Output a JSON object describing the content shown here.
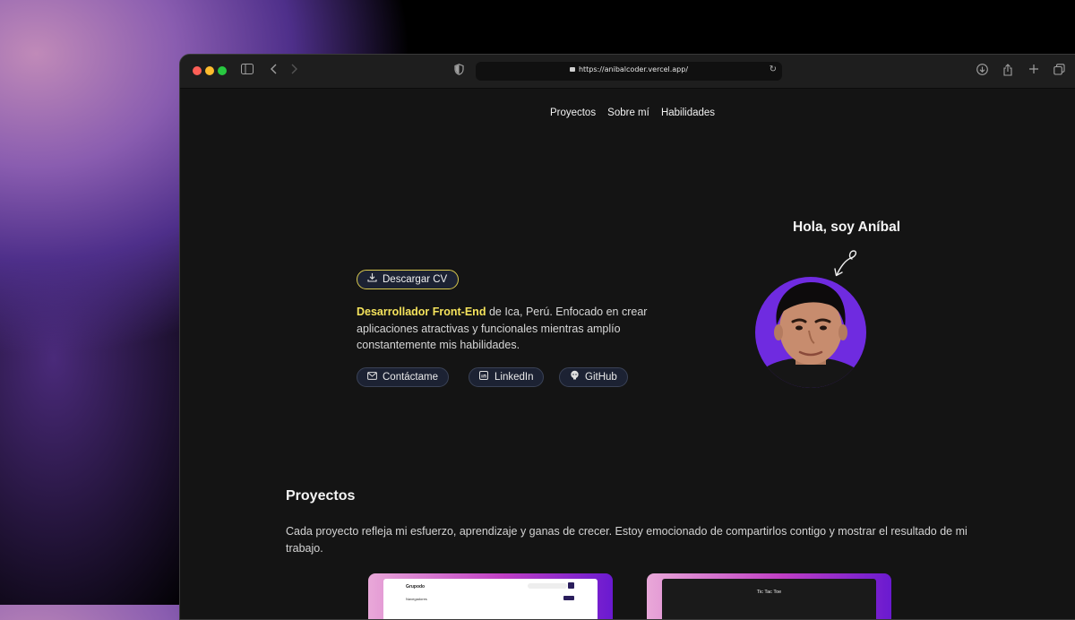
{
  "browser": {
    "url": "https://anibalcoder.vercel.app/",
    "icons": [
      "sidebar-icon",
      "back-icon",
      "forward-icon",
      "shield-icon",
      "lock-icon",
      "reload-icon",
      "download-icon",
      "share-icon",
      "new-tab-icon",
      "tabs-icon"
    ]
  },
  "nav": {
    "items": [
      "Proyectos",
      "Sobre mí",
      "Habilidades"
    ]
  },
  "hero": {
    "cv_button": "Descargar CV",
    "highlight": "Desarrollador Front-End",
    "intro_rest": " de Ica, Perú. Enfocado en crear aplicaciones atractivas y funcionales mientras amplío constantemente mis habilidades.",
    "buttons": [
      "Contáctame",
      "LinkedIn",
      "GitHub"
    ],
    "greeting": "Hola, soy Aníbal"
  },
  "projects": {
    "title": "Proyectos",
    "description": "Cada proyecto refleja mi esfuerzo, aprendizaje y ganas de crecer. Estoy emocionado de compartirlos contigo y mostrar el resultado de mi trabajo.",
    "cards": [
      {
        "title": "Grupodo",
        "subtitle": "Navegadores"
      },
      {
        "title": "Tic Tac Toe"
      }
    ]
  },
  "colors": {
    "accent_yellow": "#f5e35c",
    "avatar_bg": "#6f2be0",
    "page_bg": "#141414"
  }
}
